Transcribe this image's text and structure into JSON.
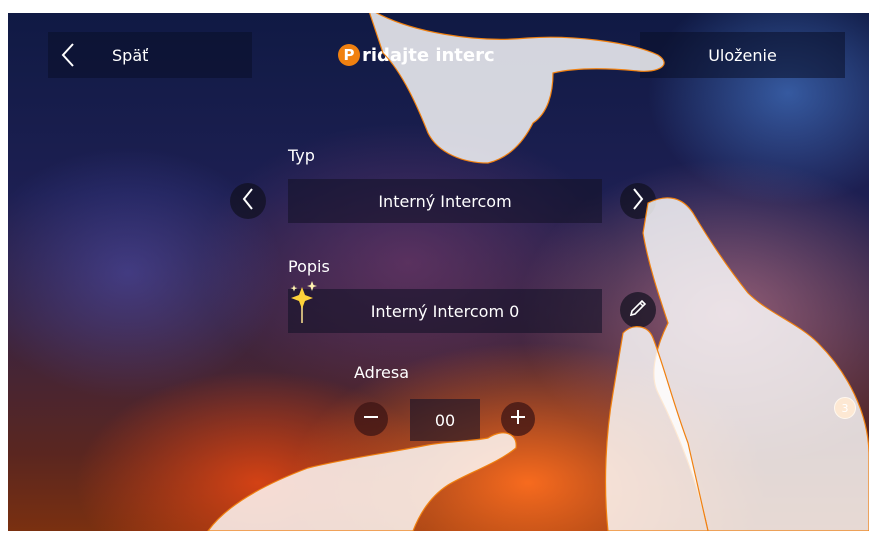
{
  "header": {
    "back_label": "Späť",
    "title_badge": "P",
    "title_text": "ridajte interc",
    "save_label": "Uloženie"
  },
  "type_section": {
    "label": "Typ",
    "value": "Interný Intercom"
  },
  "description_section": {
    "label": "Popis",
    "value": "Interný Intercom 0"
  },
  "address_section": {
    "label": "Adresa",
    "value": "00"
  },
  "callout_number": "3",
  "colors": {
    "accent": "#f08010",
    "bar_bg": "rgba(10,14,40,0.55)"
  },
  "icons": [
    "chevron-left-icon",
    "chevron-right-icon",
    "pencil-icon",
    "minus-icon",
    "plus-icon",
    "sparkle-icon"
  ]
}
